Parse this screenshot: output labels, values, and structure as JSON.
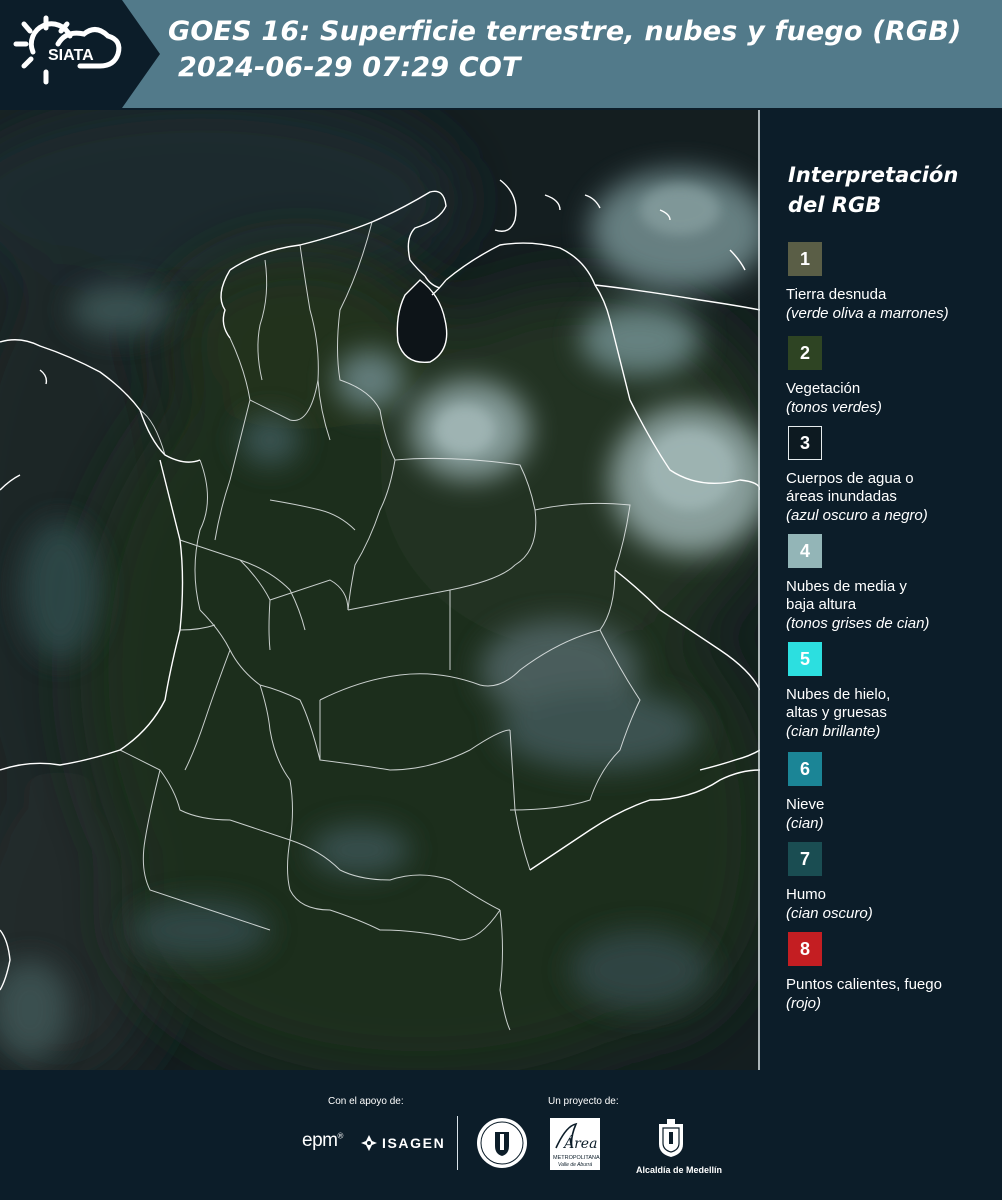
{
  "header": {
    "logo_text": "SIATA",
    "title": "GOES 16: Superficie terrestre, nubes y fuego (RGB)",
    "subtitle": "2024-06-29 07:29 COT"
  },
  "legend": {
    "title_line1": "Interpretación",
    "title_line2": "del RGB",
    "items": [
      {
        "num": "1",
        "name": "Tierra desnuda",
        "name2": "",
        "note": "(verde oliva a marrones)",
        "color": "#5a5e46"
      },
      {
        "num": "2",
        "name": "Vegetación",
        "name2": "",
        "note": "(tonos verdes)",
        "color": "#2e4423"
      },
      {
        "num": "3",
        "name": "Cuerpos de agua o",
        "name2": "áreas inundadas",
        "note": "(azul oscuro a negro)",
        "color": "#0d1a21"
      },
      {
        "num": "4",
        "name": "Nubes de media y",
        "name2": "baja altura",
        "note": "(tonos grises de cian)",
        "color": "#93b5b7"
      },
      {
        "num": "5",
        "name": "Nubes de hielo,",
        "name2": "altas y gruesas",
        "note": "(cian brillante)",
        "color": "#2cdfe0"
      },
      {
        "num": "6",
        "name": "Nieve",
        "name2": "",
        "note": "(cian)",
        "color": "#1b8596"
      },
      {
        "num": "7",
        "name": "Humo",
        "name2": "",
        "note": "(cian oscuro)",
        "color": "#1a4d52"
      },
      {
        "num": "8",
        "name": "Puntos calientes, fuego",
        "name2": "",
        "note": "(rojo)",
        "color": "#c41e22"
      }
    ]
  },
  "footer": {
    "support_label": "Con el apoyo de:",
    "project_label": "Un proyecto de:",
    "epm": "epm",
    "isagen": "ISAGEN",
    "area_line1": "Área",
    "area_line2": "METROPOLITANA",
    "area_line3": "Valle de Aburrá",
    "alcaldia": "Alcaldía de Medellín"
  },
  "colors": {
    "header_bg": "#527a8a",
    "logo_bg": "#0c1d29",
    "page_bg": "#0c1d29",
    "border": "#e6ecee"
  }
}
